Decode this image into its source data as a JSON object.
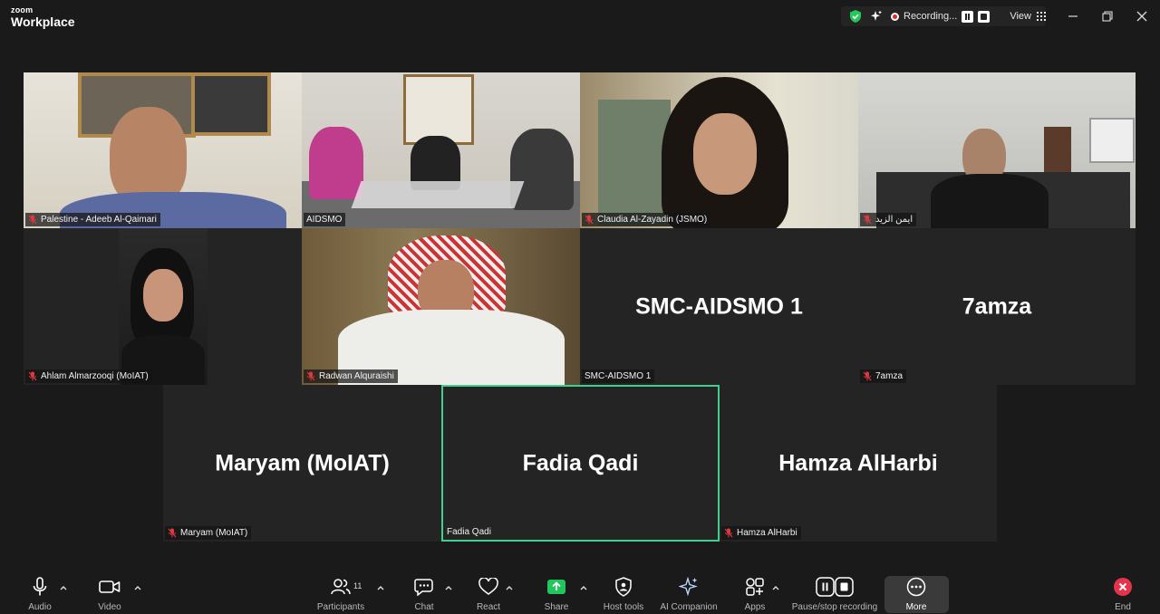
{
  "app": {
    "brand_small": "zoom",
    "brand_large": "Workplace"
  },
  "status": {
    "recording_text": "Recording...",
    "view_label": "View"
  },
  "tiles": [
    {
      "id": "t1",
      "name": "Palestine - Adeeb Al-Qaimari",
      "muted": true
    },
    {
      "id": "t2",
      "name": "AIDSMO",
      "muted": false
    },
    {
      "id": "t3",
      "name": "Claudia Al-Zayadin (JSMO)",
      "muted": true
    },
    {
      "id": "t4",
      "name": "ايمن الزيد",
      "muted": true
    },
    {
      "id": "t5",
      "name": "Ahlam Almarzooqi (MoIAT)",
      "muted": true
    },
    {
      "id": "t6",
      "name": "Radwan Alquraishi",
      "muted": true
    },
    {
      "id": "t7",
      "name": "SMC-AIDSMO 1",
      "big": "SMC-AIDSMO 1",
      "muted": false
    },
    {
      "id": "t8",
      "name": "7amza",
      "big": "7amza",
      "muted": true
    },
    {
      "id": "t9",
      "name": "Maryam (MoIAT)",
      "big": "Maryam (MoIAT)",
      "muted": true
    },
    {
      "id": "t10",
      "name": "Fadia Qadi",
      "big": "Fadia Qadi",
      "muted": false,
      "active_speaker": true
    },
    {
      "id": "t11",
      "name": "Hamza AlHarbi",
      "big": "Hamza AlHarbi",
      "muted": true
    }
  ],
  "toolbar": {
    "audio": "Audio",
    "video": "Video",
    "participants": "Participants",
    "participants_count": "11",
    "chat": "Chat",
    "react": "React",
    "share": "Share",
    "host_tools": "Host tools",
    "ai_companion": "AI Companion",
    "apps": "Apps",
    "pause_stop": "Pause/stop recording",
    "more": "More",
    "end": "End"
  },
  "colors": {
    "background": "#1a1a1a",
    "tile": "#242424",
    "active_border": "#3fcf8e",
    "share_green": "#22c55e",
    "end_red": "#e5334b",
    "muted_red": "#e0383e"
  }
}
